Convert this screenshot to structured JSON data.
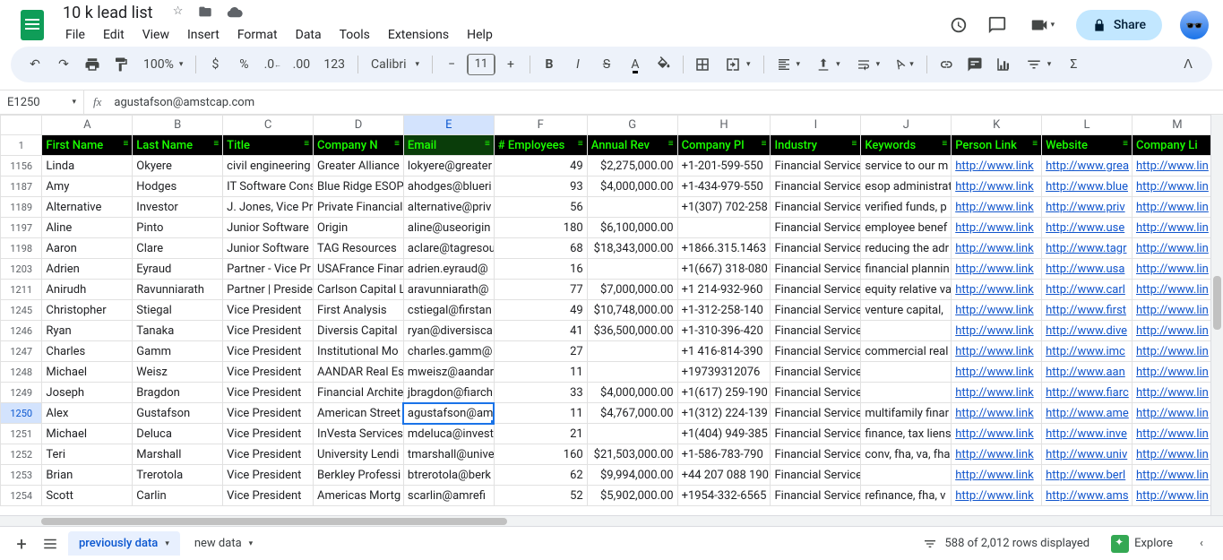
{
  "doc": {
    "title": "10 k lead list"
  },
  "menus": [
    "File",
    "Edit",
    "View",
    "Insert",
    "Format",
    "Data",
    "Tools",
    "Extensions",
    "Help"
  ],
  "share_label": "Share",
  "toolbar": {
    "zoom": "100%",
    "number_format": "123",
    "font": "Calibri",
    "font_size": "11"
  },
  "namebox": "E1250",
  "formula": "agustafson@amstcap.com",
  "col_letters": [
    "A",
    "B",
    "C",
    "D",
    "E",
    "F",
    "G",
    "H",
    "I",
    "J",
    "K",
    "L",
    "M"
  ],
  "active_col": "E",
  "active_row": "1250",
  "headers": [
    "First Name",
    "Last Name",
    "Title",
    "Company N",
    "Email",
    "# Employees",
    "Annual Rev",
    "Company Pl",
    "Industry",
    "Keywords",
    "Person Link",
    "Website",
    "Company Li"
  ],
  "header_row_num": "1",
  "rows": [
    {
      "n": "1156",
      "c": [
        "Linda",
        "Okyere",
        "civil engineering",
        "Greater Alliance",
        "lokyere@greater",
        "49",
        "$2,275,000.00",
        "+1-201-599-550",
        "Financial Service",
        "service to our m",
        "http://www.link",
        "http://www.grea",
        "http://www.lin"
      ]
    },
    {
      "n": "1187",
      "c": [
        "Amy",
        "Hodges",
        "IT Software Cons",
        "Blue Ridge ESOP",
        "ahodges@blueri",
        "93",
        "$4,000,000.00",
        "+1-434-979-550",
        "Financial Service",
        "esop administrat",
        "http://www.link",
        "http://www.blue",
        "http://www.lin"
      ]
    },
    {
      "n": "1189",
      "c": [
        "Alternative",
        "Investor",
        "J. Jones, Vice Pr",
        "Private Financial",
        "alternative@priv",
        "56",
        "",
        "+1(307) 702-258",
        "Financial Service",
        "verified funds, p",
        "http://www.link",
        "http://www.priv",
        "http://www.lin"
      ]
    },
    {
      "n": "1197",
      "c": [
        "Aline",
        "Pinto",
        "Junior Software",
        "Origin",
        "aline@useorigin",
        "180",
        "$6,100,000.00",
        "",
        "Financial Service",
        "employee benef",
        "http://www.link",
        "http://www.use",
        "http://www.lin"
      ]
    },
    {
      "n": "1198",
      "c": [
        "Aaron",
        "Clare",
        "Junior Software",
        "TAG Resources",
        "aclare@tagresou",
        "68",
        "$18,343,000.00",
        "+1866.315.1463",
        "Financial Service",
        "reducing the adr",
        "http://www.link",
        "http://www.tagr",
        "http://www.lin"
      ]
    },
    {
      "n": "1203",
      "c": [
        "Adrien",
        "Eyraud",
        "Partner - Vice Pr",
        "USAFrance Finan",
        "adrien.eyraud@",
        "16",
        "",
        "+1(667) 318-080",
        "Financial Service",
        "financial plannin",
        "http://www.link",
        "http://www.usa",
        "http://www.lin"
      ]
    },
    {
      "n": "1211",
      "c": [
        "Anirudh",
        "Ravunniarath",
        "Partner | Preside",
        "Carlson Capital L",
        "aravunniarath@",
        "77",
        "$7,000,000.00",
        "+1 214-932-960",
        "Financial Service",
        "equity relative va",
        "http://www.link",
        "http://www.carl",
        "http://www.lin"
      ]
    },
    {
      "n": "1245",
      "c": [
        "Christopher",
        "Stiegal",
        "Vice President",
        "First Analysis",
        "cstiegal@firstan",
        "49",
        "$10,748,000.00",
        "+1-312-258-140",
        "Financial Service",
        "venture capital,",
        "http://www.link",
        "http://www.first",
        "http://www.lin"
      ]
    },
    {
      "n": "1246",
      "c": [
        "Ryan",
        "Tanaka",
        "Vice President",
        "Diversis Capital",
        "ryan@diversisca",
        "41",
        "$36,500,000.00",
        "+1-310-396-420",
        "Financial Services",
        "",
        "http://www.link",
        "http://www.dive",
        "http://www.lin"
      ]
    },
    {
      "n": "1247",
      "c": [
        "Charles",
        "Gamm",
        "Vice President",
        "Institutional Mo",
        "charles.gamm@",
        "27",
        "",
        "+1 416-814-390",
        "Financial Service",
        "commercial real",
        "http://www.link",
        "http://www.imc",
        "http://www.lin"
      ]
    },
    {
      "n": "1248",
      "c": [
        "Michael",
        "Weisz",
        "Vice President",
        "AANDAR Real Es",
        "mweisz@aandar",
        "11",
        "",
        "+19739312076",
        "Financial Services",
        "",
        "http://www.link",
        "http://www.aan",
        "http://www.lin"
      ]
    },
    {
      "n": "1249",
      "c": [
        "Joseph",
        "Bragdon",
        "Vice President",
        "Financial Archite",
        "jbragdon@fiarch",
        "33",
        "$4,000,000.00",
        "+1(617) 259-190",
        "Financial Services",
        "",
        "http://www.link",
        "http://www.fiarc",
        "http://www.lin"
      ]
    },
    {
      "n": "1250",
      "c": [
        "Alex",
        "Gustafson",
        "Vice President",
        "American Street",
        "agustafson@am",
        "11",
        "$4,767,000.00",
        "+1(312) 224-139",
        "Financial Service",
        "multifamily finar",
        "http://www.link",
        "http://www.ame",
        "http://www.lin"
      ]
    },
    {
      "n": "1251",
      "c": [
        "Michael",
        "Deluca",
        "Vice President",
        "InVesta Services",
        "mdeluca@invest",
        "21",
        "",
        "+1(404) 949-385",
        "Financial Service",
        "finance, tax liens",
        "http://www.link",
        "http://www.inve",
        "http://www.lin"
      ]
    },
    {
      "n": "1252",
      "c": [
        "Teri",
        "Marshall",
        "Vice President",
        "University Lendi",
        "tmarshall@unive",
        "160",
        "$21,503,000.00",
        "+1-586-783-790",
        "Financial Service",
        "conv, fha, va, fha",
        "http://www.link",
        "http://www.univ",
        "http://www.lin"
      ]
    },
    {
      "n": "1253",
      "c": [
        "Brian",
        "Trerotola",
        "Vice President",
        "Berkley Professi",
        "btrerotola@berk",
        "62",
        "$9,994,000.00",
        "+44 207 088 190",
        "Financial Services",
        "",
        "http://www.link",
        "http://www.berl",
        "http://www.lin"
      ]
    },
    {
      "n": "1254",
      "c": [
        "Scott",
        "Carlin",
        "Vice President",
        "Americas Mortg",
        "scarlin@amrefi",
        "52",
        "$5,902,000.00",
        "+1954-332-6565",
        "Financial Service",
        "refinance, fha, v",
        "http://www.link",
        "http://www.ams",
        "http://www.lin"
      ]
    }
  ],
  "link_cols": [
    10,
    11,
    12
  ],
  "num_cols": [
    5,
    6
  ],
  "sheets": [
    {
      "name": "previously data",
      "active": true
    },
    {
      "name": "new data",
      "active": false
    }
  ],
  "rows_displayed": "588 of 2,012 rows displayed",
  "explore": "Explore"
}
